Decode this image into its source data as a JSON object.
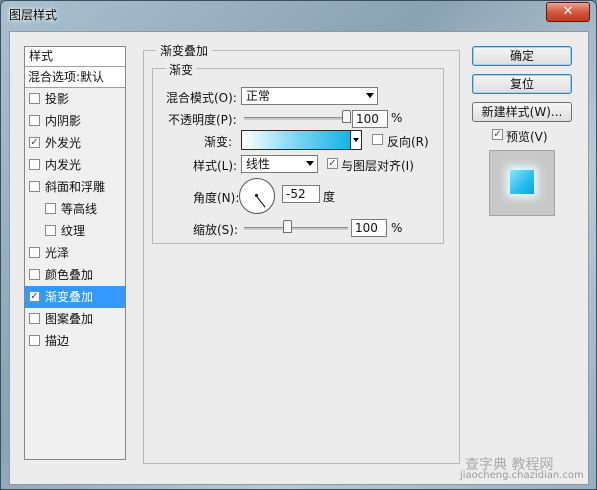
{
  "window": {
    "title": "图层样式",
    "close_glyph": "✕"
  },
  "style_list": {
    "header": "样式",
    "blend_options": "混合选项:默认",
    "items": [
      {
        "label": "投影",
        "checked": false,
        "sub": false,
        "selected": false
      },
      {
        "label": "内阴影",
        "checked": false,
        "sub": false,
        "selected": false
      },
      {
        "label": "外发光",
        "checked": true,
        "sub": false,
        "selected": false
      },
      {
        "label": "内发光",
        "checked": false,
        "sub": false,
        "selected": false
      },
      {
        "label": "斜面和浮雕",
        "checked": false,
        "sub": false,
        "selected": false
      },
      {
        "label": "等高线",
        "checked": false,
        "sub": true,
        "selected": false
      },
      {
        "label": "纹理",
        "checked": false,
        "sub": true,
        "selected": false
      },
      {
        "label": "光泽",
        "checked": false,
        "sub": false,
        "selected": false
      },
      {
        "label": "颜色叠加",
        "checked": false,
        "sub": false,
        "selected": false
      },
      {
        "label": "渐变叠加",
        "checked": true,
        "sub": false,
        "selected": true
      },
      {
        "label": "图案叠加",
        "checked": false,
        "sub": false,
        "selected": false
      },
      {
        "label": "描边",
        "checked": false,
        "sub": false,
        "selected": false
      }
    ]
  },
  "panel": {
    "title": "渐变叠加",
    "group_title": "渐变",
    "blend_mode_label": "混合模式(O):",
    "blend_mode_value": "正常",
    "opacity_label": "不透明度(P):",
    "opacity_value": "100",
    "opacity_fraction": 1.0,
    "opacity_unit": "%",
    "gradient_label": "渐变:",
    "reverse_label": "反向(R)",
    "reverse_checked": false,
    "style_label": "样式(L):",
    "style_value": "线性",
    "align_label": "与图层对齐(I)",
    "align_checked": true,
    "angle_label": "角度(N):",
    "angle_value": "-52",
    "angle_unit": "度",
    "scale_label": "缩放(S):",
    "scale_value": "100",
    "scale_fraction": 0.4,
    "scale_unit": "%"
  },
  "buttons": {
    "ok": "确定",
    "reset": "复位",
    "new_style": "新建样式(W)...",
    "preview_label": "预览(V)",
    "preview_checked": true
  },
  "watermark": {
    "text": "查字典 教程网",
    "url": "jiaocheng.chazidian.com"
  },
  "colors": {
    "selection": "#3399ff",
    "gradient_start": "#ffffff",
    "gradient_end": "#00aee6"
  }
}
